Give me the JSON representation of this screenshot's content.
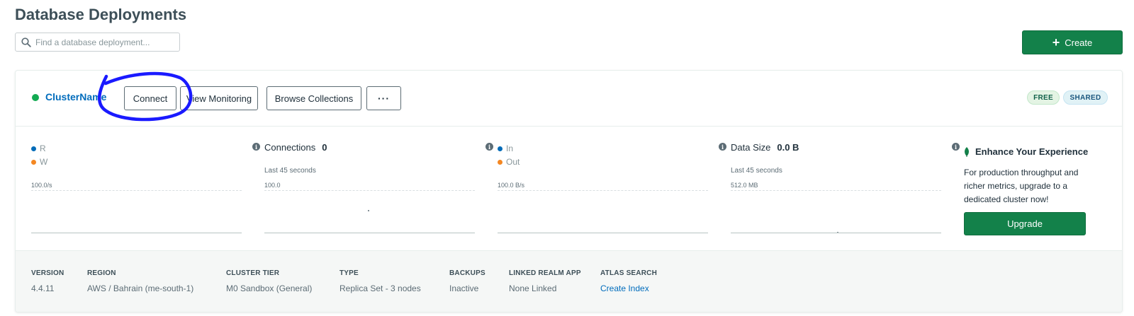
{
  "page": {
    "title": "Database Deployments"
  },
  "search": {
    "placeholder": "Find a database deployment..."
  },
  "header": {
    "create_label": "Create"
  },
  "cluster": {
    "name": "ClusterName",
    "status_color": "#13aa52",
    "buttons": {
      "connect": "Connect",
      "monitoring": "View Monitoring",
      "browse": "Browse Collections",
      "more": "···"
    },
    "badges": {
      "free": "FREE",
      "shared": "SHARED"
    }
  },
  "metrics": {
    "ops": {
      "legend_r": "R",
      "legend_w": "W",
      "scale": "100.0/s"
    },
    "connections": {
      "label": "Connections",
      "value": "0",
      "window": "Last 45 seconds",
      "scale": "100.0"
    },
    "network": {
      "legend_in": "In",
      "legend_out": "Out",
      "scale": "100.0 B/s"
    },
    "data_size": {
      "label": "Data Size",
      "value": "0.0 B",
      "window": "Last 45 seconds",
      "scale": "512.0 MB"
    }
  },
  "upsell": {
    "title": "Enhance Your Experience",
    "body": "For production throughput and richer metrics, upgrade to a dedicated cluster now!",
    "button": "Upgrade"
  },
  "footer": {
    "version": {
      "label": "VERSION",
      "value": "4.4.11"
    },
    "region": {
      "label": "REGION",
      "value": "AWS / Bahrain (me-south-1)"
    },
    "tier": {
      "label": "CLUSTER TIER",
      "value": "M0 Sandbox (General)"
    },
    "type": {
      "label": "TYPE",
      "value": "Replica Set - 3 nodes"
    },
    "backups": {
      "label": "BACKUPS",
      "value": "Inactive"
    },
    "realm": {
      "label": "LINKED REALM APP",
      "value": "None Linked"
    },
    "atlas_search": {
      "label": "ATLAS SEARCH",
      "value": "Create Index"
    }
  },
  "colors": {
    "accent_green": "#13814a",
    "link_blue": "#006cbc",
    "annotation_blue": "#1a1aff"
  }
}
